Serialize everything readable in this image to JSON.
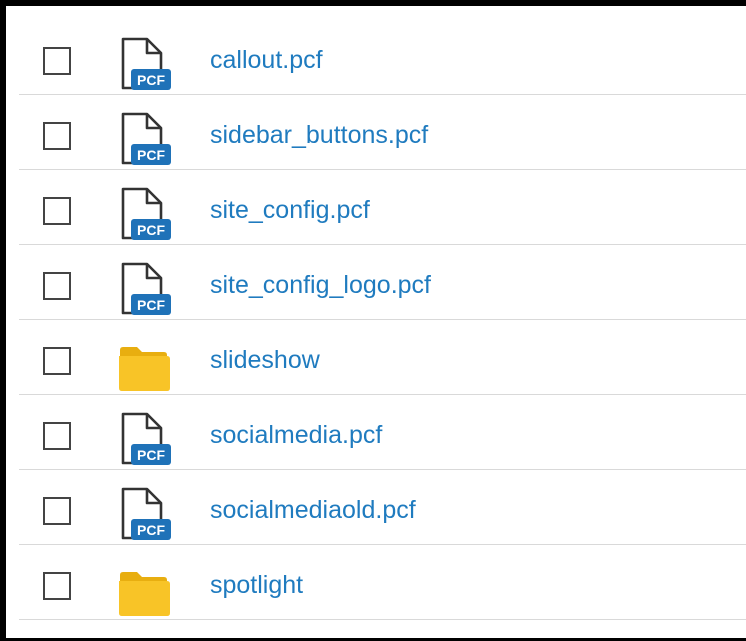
{
  "colors": {
    "link": "#1f7bbf",
    "badge": "#1f72b8",
    "folder": "#f8c427",
    "divider": "#d9d9d9"
  },
  "files": [
    {
      "name": "callout.pcf",
      "type": "pcf",
      "icon": "pcf-file-icon",
      "badge": "PCF",
      "checked": false
    },
    {
      "name": "sidebar_buttons.pcf",
      "type": "pcf",
      "icon": "pcf-file-icon",
      "badge": "PCF",
      "checked": false
    },
    {
      "name": "site_config.pcf",
      "type": "pcf",
      "icon": "pcf-file-icon",
      "badge": "PCF",
      "checked": false
    },
    {
      "name": "site_config_logo.pcf",
      "type": "pcf",
      "icon": "pcf-file-icon",
      "badge": "PCF",
      "checked": false
    },
    {
      "name": "slideshow",
      "type": "folder",
      "icon": "folder-icon",
      "checked": false
    },
    {
      "name": "socialmedia.pcf",
      "type": "pcf",
      "icon": "pcf-file-icon",
      "badge": "PCF",
      "checked": false
    },
    {
      "name": "socialmediaold.pcf",
      "type": "pcf",
      "icon": "pcf-file-icon",
      "badge": "PCF",
      "checked": false
    },
    {
      "name": "spotlight",
      "type": "folder",
      "icon": "folder-icon",
      "checked": false
    }
  ]
}
